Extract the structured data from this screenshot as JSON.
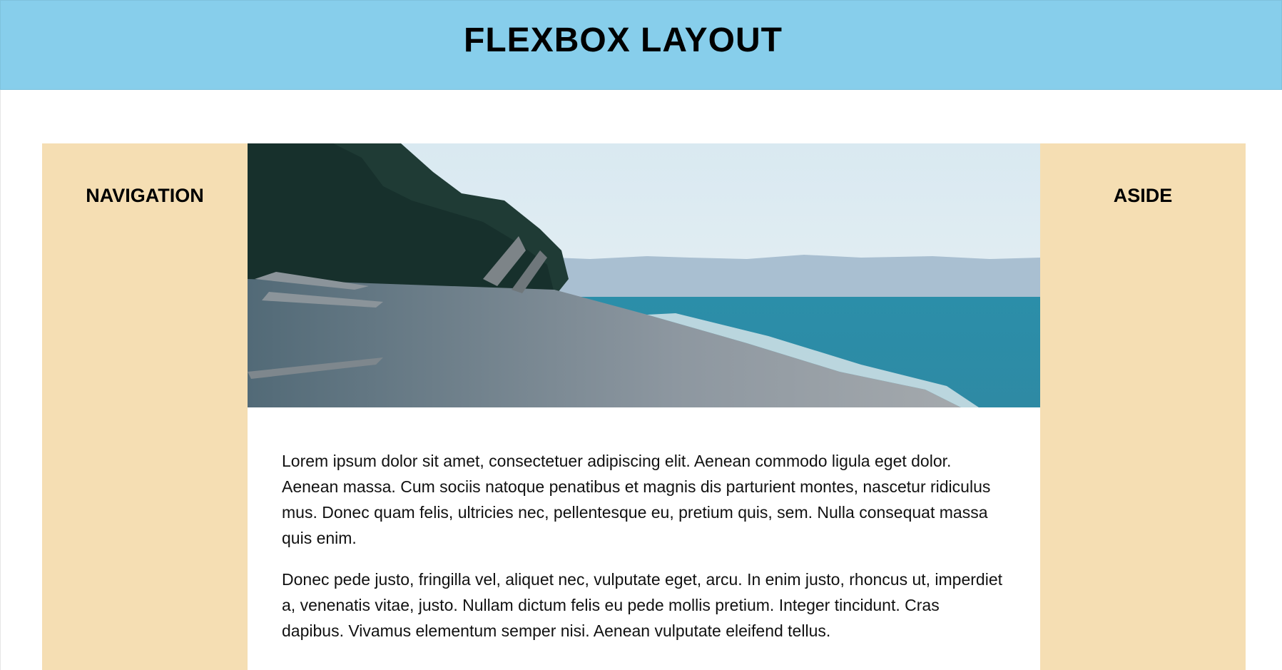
{
  "header": {
    "title": "FLEXBOX LAYOUT"
  },
  "nav": {
    "title": "NAVIGATION"
  },
  "aside": {
    "title": "ASIDE"
  },
  "main": {
    "paragraphs": [
      "Lorem ipsum dolor sit amet, consectetuer adipiscing elit. Aenean commodo ligula eget dolor. Aenean massa. Cum sociis natoque penatibus et magnis dis parturient montes, nascetur ridiculus mus. Donec quam felis, ultricies nec, pellentesque eu, pretium quis, sem. Nulla consequat massa quis enim.",
      "Donec pede justo, fringilla vel, aliquet nec, vulputate eget, arcu. In enim justo, rhoncus ut, imperdiet a, venenatis vitae, justo. Nullam dictum felis eu pede mollis pretium. Integer tincidunt. Cras dapibus. Vivamus elementum semper nisi. Aenean vulputate eleifend tellus."
    ]
  },
  "colors": {
    "header_bg": "#87ceeb",
    "sidebar_bg": "#f5deb3",
    "main_bg": "#ffffff"
  }
}
